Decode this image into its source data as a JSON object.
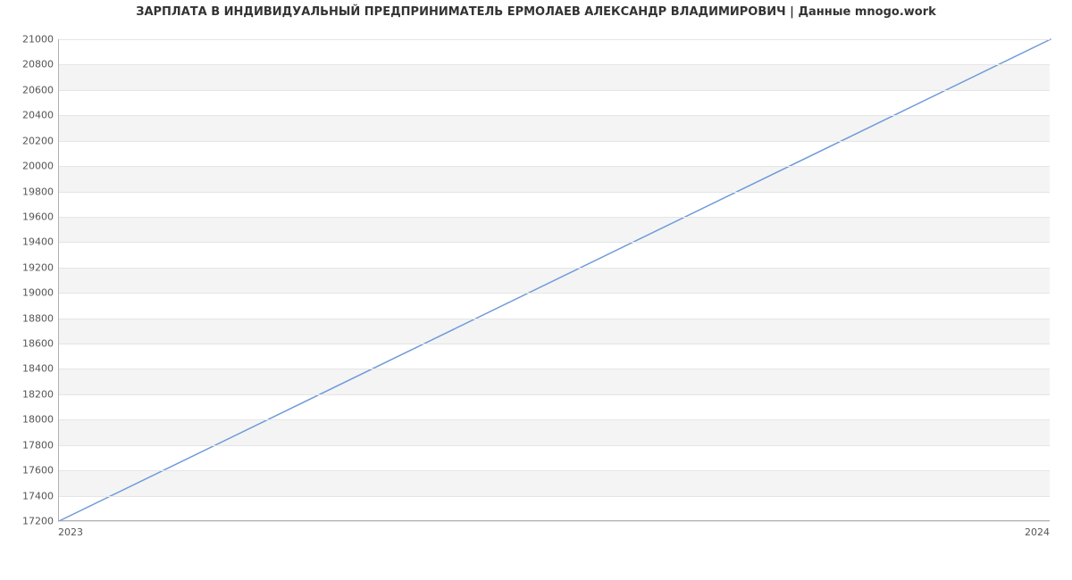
{
  "chart_data": {
    "type": "line",
    "title": "ЗАРПЛАТА В ИНДИВИДУАЛЬНЫЙ ПРЕДПРИНИМАТЕЛЬ ЕРМОЛАЕВ АЛЕКСАНДР ВЛАДИМИРОВИЧ | Данные mnogo.work",
    "xlabel": "",
    "ylabel": "",
    "x": [
      2023,
      2024
    ],
    "values": [
      17200,
      21000
    ],
    "xlim": [
      2023,
      2024
    ],
    "ylim": [
      17200,
      21000
    ],
    "x_ticks": [
      2023,
      2024
    ],
    "y_ticks": [
      17200,
      17400,
      17600,
      17800,
      18000,
      18200,
      18400,
      18600,
      18800,
      19000,
      19200,
      19400,
      19600,
      19800,
      20000,
      20200,
      20400,
      20600,
      20800,
      21000
    ],
    "line_color": "#6f9bd8",
    "band_color": "#f4f4f4",
    "grid": true
  }
}
